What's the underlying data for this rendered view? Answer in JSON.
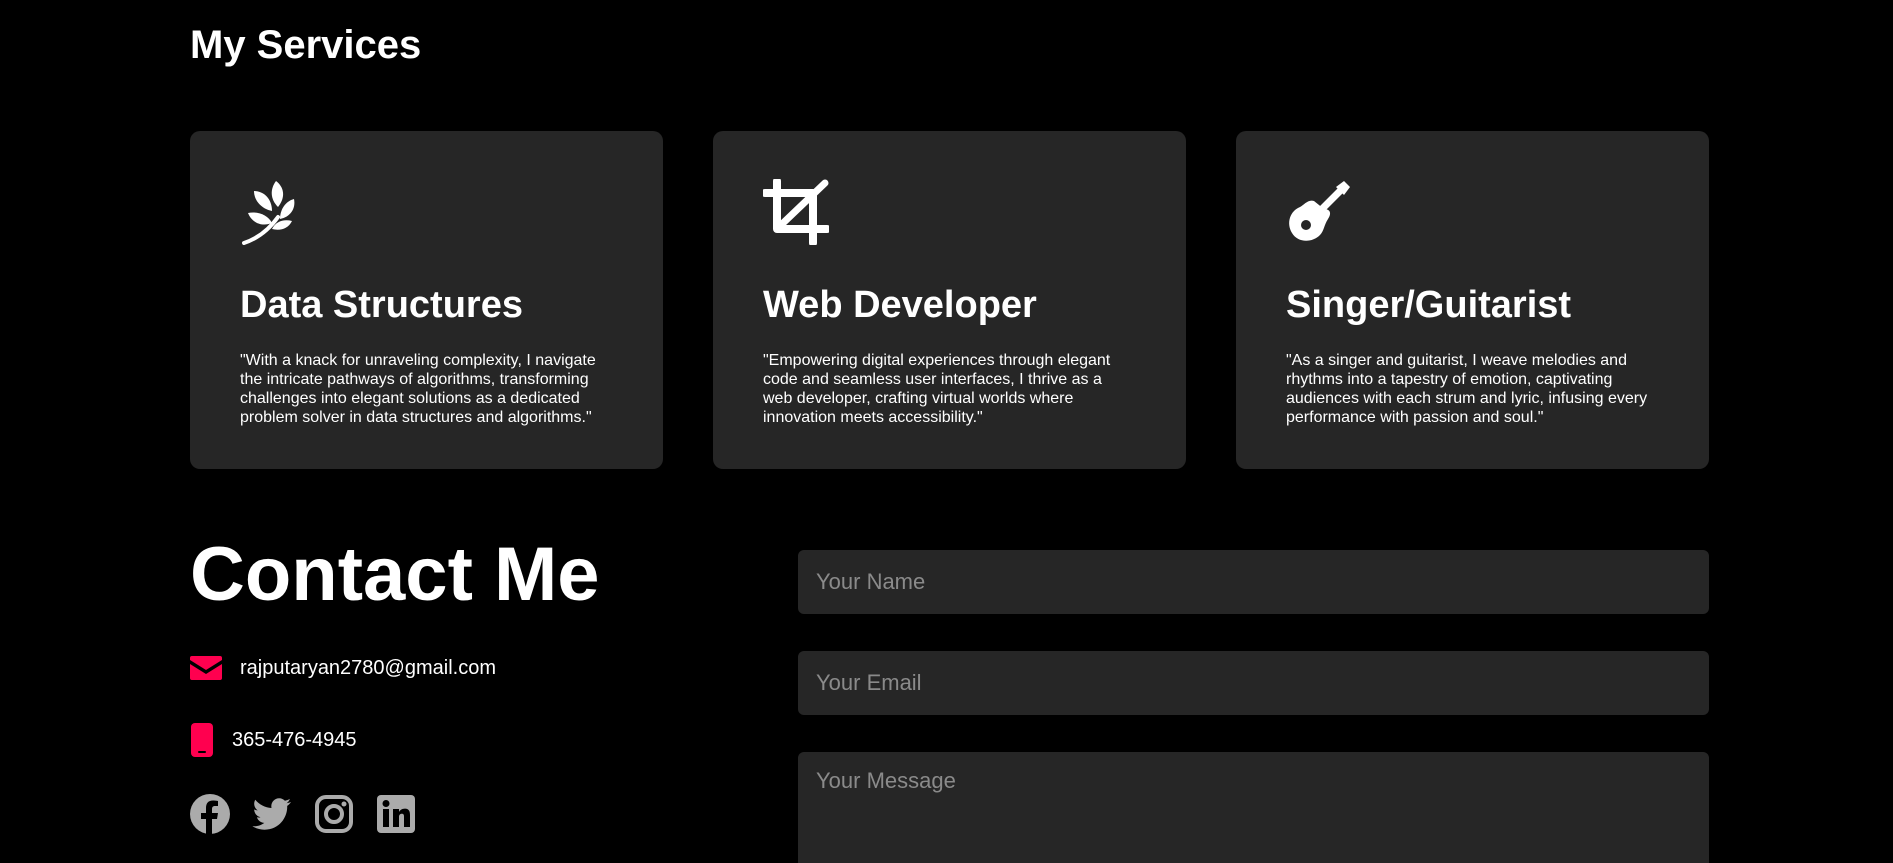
{
  "services": {
    "title": "My Services",
    "cards": [
      {
        "icon": "leaf-sprig-icon",
        "title": "Data Structures",
        "description": "\"With a knack for unraveling complexity, I navigate the intricate pathways of algorithms, transforming challenges into elegant solutions as a dedicated problem solver in data structures and algorithms.\""
      },
      {
        "icon": "crop-icon",
        "title": "Web Developer",
        "description": "\"Empowering digital experiences through elegant code and seamless user interfaces, I thrive as a web developer, crafting virtual worlds where innovation meets accessibility.\""
      },
      {
        "icon": "guitar-icon",
        "title": "Singer/Guitarist",
        "description": "\"As a singer and guitarist, I weave melodies and rhythms into a tapestry of emotion, captivating audiences with each strum and lyric, infusing every performance with passion and soul.\""
      }
    ]
  },
  "contact": {
    "title": "Contact Me",
    "email": "rajputaryan2780@gmail.com",
    "phone": "365-476-4945",
    "email_icon": "envelope-icon",
    "phone_icon": "mobile-phone-icon",
    "socials": [
      "facebook-icon",
      "twitter-icon",
      "instagram-icon",
      "linkedin-icon"
    ]
  },
  "form": {
    "name_placeholder": "Your Name",
    "email_placeholder": "Your Email",
    "message_placeholder": "Your Message"
  },
  "colors": {
    "background": "#000000",
    "card": "#262626",
    "accent": "#ff004f",
    "social_icon": "#ababab",
    "placeholder": "#8a8a8a"
  }
}
